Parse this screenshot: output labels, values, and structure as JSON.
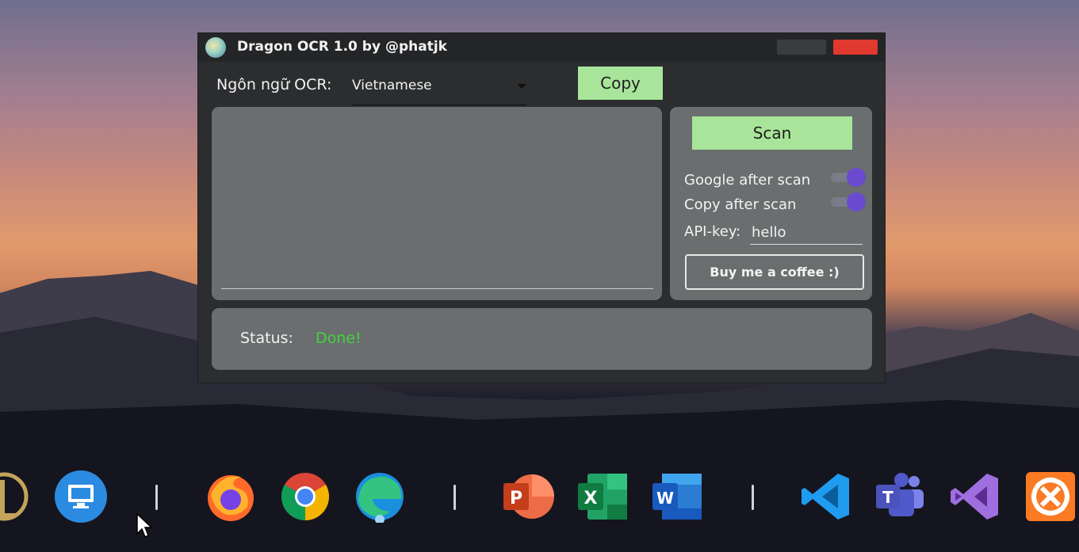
{
  "window": {
    "title": "Dragon OCR 1.0 by @phatjk",
    "lang_label": "Ngôn ngữ OCR:",
    "lang_value": "Vietnamese",
    "copy_label": "Copy",
    "scan_label": "Scan",
    "google_after_scan": {
      "label": "Google after scan",
      "on": true
    },
    "copy_after_scan": {
      "label": "Copy after scan",
      "on": true
    },
    "api_label": "API-key:",
    "api_value": "hello",
    "coffee_label": "Buy me a coffee :)",
    "status_label": "Status:",
    "status_value": "Done!",
    "colors": {
      "accent_button": "#a8e59b",
      "panel": "#6a6e6f",
      "close": "#e0392f",
      "toggle": "#6b4ad0",
      "status_done": "#42d53a"
    }
  },
  "taskbar": {
    "icons": [
      "league-of-legends-icon",
      "remote-desktop-icon",
      "firefox-icon",
      "chrome-icon",
      "edge-icon",
      "powerpoint-icon",
      "excel-icon",
      "word-icon",
      "vscode-icon",
      "teams-icon",
      "visual-studio-icon",
      "xampp-icon"
    ]
  }
}
